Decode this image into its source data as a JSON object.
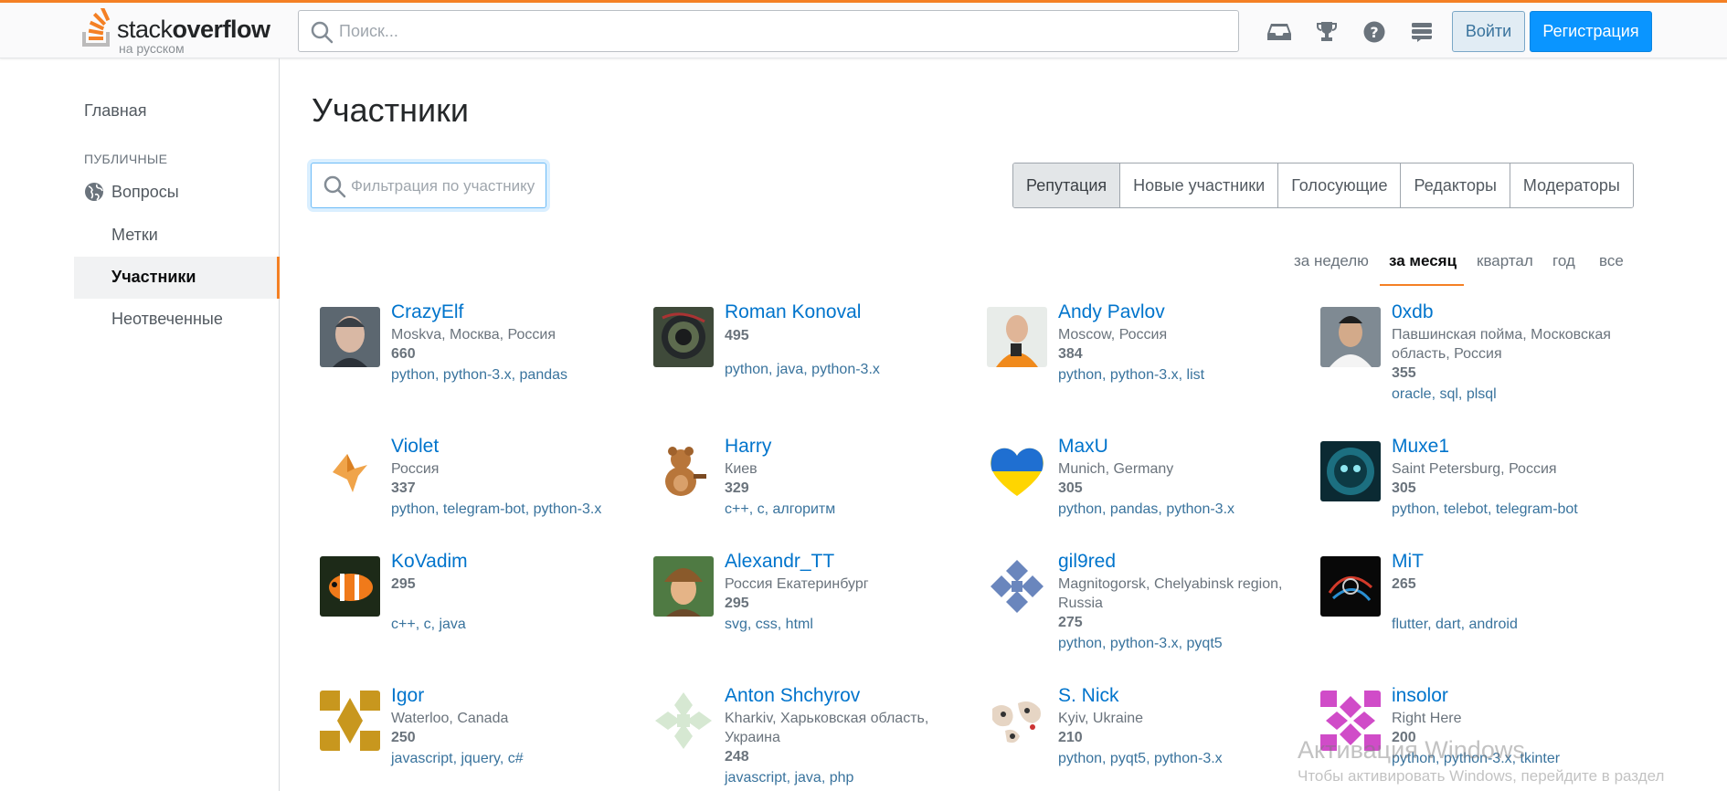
{
  "header": {
    "logo_stack": "stack",
    "logo_overflow": "overflow",
    "logo_sub": "на русском",
    "search_placeholder": "Поиск...",
    "login_label": "Войти",
    "register_label": "Регистрация",
    "icons": [
      "inbox-icon",
      "achievements-icon",
      "help-icon",
      "site-switcher-icon"
    ],
    "accent_color": "#f48024",
    "primary_color": "#0a95ff"
  },
  "sidebar": {
    "home": "Главная",
    "section_heading": "ПУБЛИЧНЫЕ",
    "questions": "Вопросы",
    "tags": "Метки",
    "users": "Участники",
    "unanswered": "Неотвеченные"
  },
  "main": {
    "title": "Участники",
    "filter_placeholder": "Фильтрация по участнику",
    "tabs": [
      "Репутация",
      "Новые участники",
      "Голосующие",
      "Редакторы",
      "Модераторы"
    ],
    "selected_tab": "Репутация",
    "periods": [
      "за неделю",
      "за месяц",
      "квартал",
      "год",
      "все"
    ],
    "selected_period": "за месяц"
  },
  "users": [
    {
      "name": "CrazyElf",
      "location": "Moskva, Москва, Россия",
      "rep": "660",
      "tags": "python, python-3.x, pandas"
    },
    {
      "name": "Roman Konoval",
      "location": "",
      "rep": "495",
      "tags": "python, java, python-3.x"
    },
    {
      "name": "Andy Pavlov",
      "location": "Moscow, Россия",
      "rep": "384",
      "tags": "python, python-3.x, list"
    },
    {
      "name": "0xdb",
      "location": "Павшинская пойма, Московская область, Россия",
      "rep": "355",
      "tags": "oracle, sql, plsql"
    },
    {
      "name": "Violet",
      "location": "Россия",
      "rep": "337",
      "tags": "python, telegram-bot, python-3.x"
    },
    {
      "name": "Harry",
      "location": "Киев",
      "rep": "329",
      "tags": "c++, c, алгоритм"
    },
    {
      "name": "MaxU",
      "location": "Munich, Germany",
      "rep": "305",
      "tags": "python, pandas, python-3.x"
    },
    {
      "name": "Muxe1",
      "location": "Saint Petersburg, Россия",
      "rep": "305",
      "tags": "python, telebot, telegram-bot"
    },
    {
      "name": "KoVadim",
      "location": "",
      "rep": "295",
      "tags": "c++, c, java"
    },
    {
      "name": "Alexandr_TT",
      "location": "Россия Екатеринбург",
      "rep": "295",
      "tags": "svg, css, html"
    },
    {
      "name": "gil9red",
      "location": "Magnitogorsk, Chelyabinsk region, Russia",
      "rep": "275",
      "tags": "python, python-3.x, pyqt5"
    },
    {
      "name": "MiT",
      "location": "",
      "rep": "265",
      "tags": "flutter, dart, android"
    },
    {
      "name": "Igor",
      "location": "Waterloo, Canada",
      "rep": "250",
      "tags": "javascript, jquery, c#"
    },
    {
      "name": "Anton Shchyrov",
      "location": "Kharkiv, Харьковская область, Украина",
      "rep": "248",
      "tags": "javascript, java, php"
    },
    {
      "name": "S. Nick",
      "location": "Kyiv, Ukraine",
      "rep": "210",
      "tags": "python, pyqt5, python-3.x"
    },
    {
      "name": "insolor",
      "location": "Right Here",
      "rep": "200",
      "tags": "python, python-3.x, tkinter"
    }
  ],
  "watermark": {
    "line1": "Активация Windows",
    "line2": "Чтобы активировать Windows, перейдите в раздел"
  }
}
